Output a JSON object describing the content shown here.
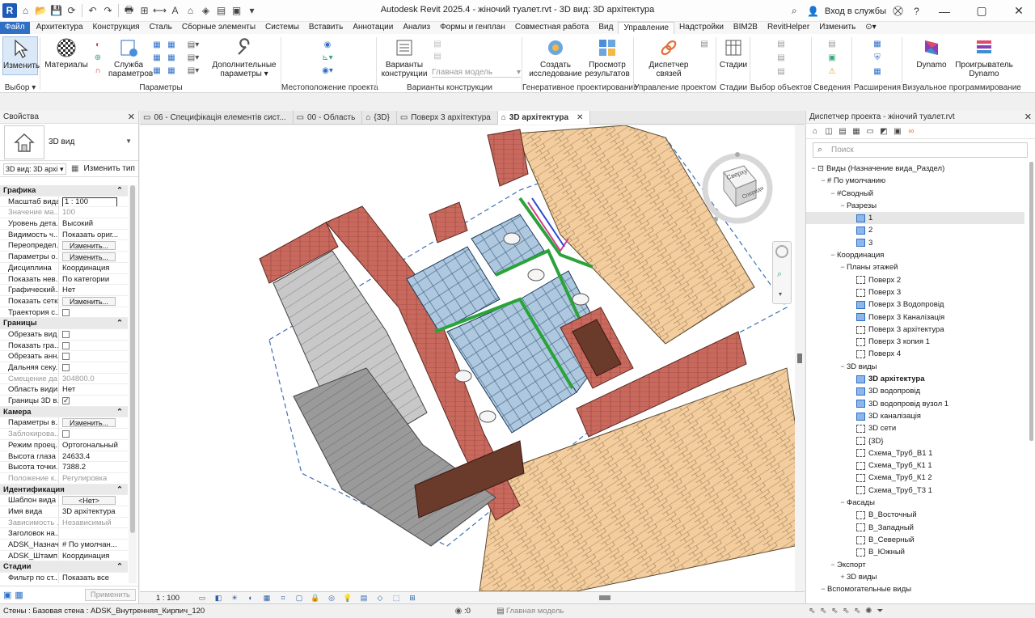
{
  "window": {
    "title": "Autodesk Revit 2025.4 - жіночий туалет.rvt - 3D вид: 3D архітектура",
    "login": "Вход в службы",
    "app_letter": "R"
  },
  "ribbon_tabs": [
    "Файл",
    "Архитектура",
    "Конструкция",
    "Сталь",
    "Сборные элементы",
    "Системы",
    "Вставить",
    "Аннотации",
    "Анализ",
    "Формы и генплан",
    "Совместная работа",
    "Вид",
    "Управление",
    "Надстройки",
    "BIM2B",
    "RevitHelper",
    "Изменить"
  ],
  "ribbon": {
    "select_button": "Изменить",
    "select_group": "Выбор",
    "materials": "Материалы",
    "param_service": [
      "Служба",
      "параметров"
    ],
    "more_params": [
      "Дополнительные",
      "параметры"
    ],
    "group_params": "Параметры",
    "group_location": "Местоположение проекта",
    "design_options": [
      "Варианты",
      "конструкции"
    ],
    "main_model": "Главная модель",
    "group_design_options": "Варианты конструкции",
    "create_study": [
      "Создать",
      "исследование"
    ],
    "view_results": [
      "Просмотр",
      "результатов"
    ],
    "group_generative": "Генеративное проектирование",
    "link_manager": [
      "Диспетчер",
      "связей"
    ],
    "group_project_mgmt": "Управление проектом",
    "phases": "Стадии",
    "group_phases": "Стадии",
    "group_select_objects": "Выбор объектов",
    "group_info": "Сведения",
    "group_extensions": "Расширения",
    "dynamo": "Dynamo",
    "dynamo_player": [
      "Проигрыватель",
      "Dynamo"
    ],
    "group_visual_programming": "Визуальное программирование"
  },
  "properties": {
    "title": "Свойства",
    "type_name": "3D вид",
    "instance_selector": "3D вид: 3D архі",
    "edit_type": "Изменить тип",
    "rows": [
      {
        "k": "Графика",
        "section": true
      },
      {
        "k": "Масштаб вида",
        "v": "1 : 100",
        "input": true
      },
      {
        "k": "Значение ма...",
        "v": "100",
        "gray": true
      },
      {
        "k": "Уровень дета...",
        "v": "Высокий"
      },
      {
        "k": "Видимость ч...",
        "v": "Показать ориг..."
      },
      {
        "k": "Переопредел...",
        "v": "Изменить...",
        "btn": true
      },
      {
        "k": "Параметры о...",
        "v": "Изменить...",
        "btn": true
      },
      {
        "k": "Дисциплина",
        "v": "Координация"
      },
      {
        "k": "Показать нев...",
        "v": "По категории"
      },
      {
        "k": "Графический...",
        "v": "Нет"
      },
      {
        "k": "Показать сетки",
        "v": "Изменить...",
        "btn": true
      },
      {
        "k": "Траектория с...",
        "v": "",
        "cb": false
      },
      {
        "k": "Границы",
        "section": true
      },
      {
        "k": "Обрезать вид",
        "v": "",
        "cb": false
      },
      {
        "k": "Показать гра...",
        "v": "",
        "cb": false
      },
      {
        "k": "Обрезать анн...",
        "v": "",
        "cb": false
      },
      {
        "k": "Дальняя секу...",
        "v": "",
        "cb": false
      },
      {
        "k": "Смещение да...",
        "v": "304800.0",
        "gray": true
      },
      {
        "k": "Область види...",
        "v": "Нет"
      },
      {
        "k": "Границы 3D в...",
        "v": "",
        "cb": true
      },
      {
        "k": "Камера",
        "section": true
      },
      {
        "k": "Параметры в...",
        "v": "Изменить...",
        "btn": true
      },
      {
        "k": "Заблокирова...",
        "v": "",
        "cb": false,
        "gray": true
      },
      {
        "k": "Режим проец...",
        "v": "Ортогональный"
      },
      {
        "k": "Высота глаза ...",
        "v": "24633.4"
      },
      {
        "k": "Высота точки...",
        "v": "7388.2"
      },
      {
        "k": "Положение к...",
        "v": "Регулировка",
        "gray": true
      },
      {
        "k": "Идентификация",
        "section": true
      },
      {
        "k": "Шаблон вида",
        "v": "<Нет>",
        "btn": true
      },
      {
        "k": "Имя вида",
        "v": "3D архітектура"
      },
      {
        "k": "Зависимость ...",
        "v": "Независимый",
        "gray": true
      },
      {
        "k": "Заголовок на...",
        "v": ""
      },
      {
        "k": "ADSK_Назнач...",
        "v": "# По умолчан..."
      },
      {
        "k": "ADSK_Штамп ...",
        "v": "Координация"
      },
      {
        "k": "Стадии",
        "section": true
      },
      {
        "k": "Фильтр по ст...",
        "v": "Показать все"
      }
    ],
    "apply": "Применить"
  },
  "doc_tabs": [
    {
      "label": "06 - Специфікація елементів сист...",
      "active": false
    },
    {
      "label": "00 - Область",
      "active": false
    },
    {
      "label": "{3D}",
      "active": false
    },
    {
      "label": "Поверх 3 архітектура",
      "active": false
    },
    {
      "label": "3D архітектура",
      "active": true
    }
  ],
  "viewcube": {
    "face_top": "Сверху",
    "face_front": "Спереди"
  },
  "view_scale": "1 : 100",
  "browser": {
    "title": "Диспетчер проекта - жіночий туалет.rvt",
    "search_placeholder": "Поиск",
    "tree": [
      {
        "d": 0,
        "t": "−",
        "label": "Виды (Назначение вида_Раздел)",
        "icon": "views"
      },
      {
        "d": 1,
        "t": "−",
        "label": "# По умолчанию"
      },
      {
        "d": 2,
        "t": "−",
        "label": "#Сводный"
      },
      {
        "d": 3,
        "t": "−",
        "label": "Разрезы"
      },
      {
        "d": 4,
        "label": "1",
        "icon": "solid",
        "sel": true
      },
      {
        "d": 4,
        "label": "2",
        "icon": "solid"
      },
      {
        "d": 4,
        "label": "3",
        "icon": "solid"
      },
      {
        "d": 2,
        "t": "−",
        "label": "Координация"
      },
      {
        "d": 3,
        "t": "−",
        "label": "Планы этажей"
      },
      {
        "d": 4,
        "label": "Поверх 2",
        "icon": "dash"
      },
      {
        "d": 4,
        "label": "Поверх 3",
        "icon": "dash"
      },
      {
        "d": 4,
        "label": "Поверх 3 Водопровід",
        "icon": "solid"
      },
      {
        "d": 4,
        "label": "Поверх 3 Каналізація",
        "icon": "solid"
      },
      {
        "d": 4,
        "label": "Поверх 3 архітектура",
        "icon": "dash"
      },
      {
        "d": 4,
        "label": "Поверх 3 копия 1",
        "icon": "dash"
      },
      {
        "d": 4,
        "label": "Поверх 4",
        "icon": "dash"
      },
      {
        "d": 3,
        "t": "−",
        "label": "3D виды"
      },
      {
        "d": 4,
        "label": "3D архітектура",
        "icon": "solid",
        "bold": true
      },
      {
        "d": 4,
        "label": "3D водопровід",
        "icon": "solid"
      },
      {
        "d": 4,
        "label": "3D водопровід вузол 1",
        "icon": "solid"
      },
      {
        "d": 4,
        "label": "3D каналізація",
        "icon": "solid"
      },
      {
        "d": 4,
        "label": "3D сети",
        "icon": "dash"
      },
      {
        "d": 4,
        "label": "{3D}",
        "icon": "dash"
      },
      {
        "d": 4,
        "label": "Схема_Труб_В1 1",
        "icon": "dash"
      },
      {
        "d": 4,
        "label": "Схема_Труб_К1 1",
        "icon": "dash"
      },
      {
        "d": 4,
        "label": "Схема_Труб_К1 2",
        "icon": "dash"
      },
      {
        "d": 4,
        "label": "Схема_Труб_Т3 1",
        "icon": "dash"
      },
      {
        "d": 3,
        "t": "−",
        "label": "Фасады"
      },
      {
        "d": 4,
        "label": "В_Восточный",
        "icon": "dash"
      },
      {
        "d": 4,
        "label": "В_Западный",
        "icon": "dash"
      },
      {
        "d": 4,
        "label": "В_Северный",
        "icon": "dash"
      },
      {
        "d": 4,
        "label": "В_Южный",
        "icon": "dash"
      },
      {
        "d": 2,
        "t": "−",
        "label": "Экспорт"
      },
      {
        "d": 3,
        "t": "+",
        "label": "3D виды"
      },
      {
        "d": 1,
        "t": "−",
        "label": "Вспомогательные виды"
      }
    ]
  },
  "status": {
    "text": "Стены : Базовая стена : ADSK_Внутренняя_Кирпич_120",
    "zero": ":0",
    "model": "Главная модель"
  },
  "colors": {
    "accent": "#2f6fc4",
    "brick": "#c8695f",
    "wood": "#f0c79a",
    "tile": "#a9c4dd",
    "green": "#2aa33a"
  }
}
